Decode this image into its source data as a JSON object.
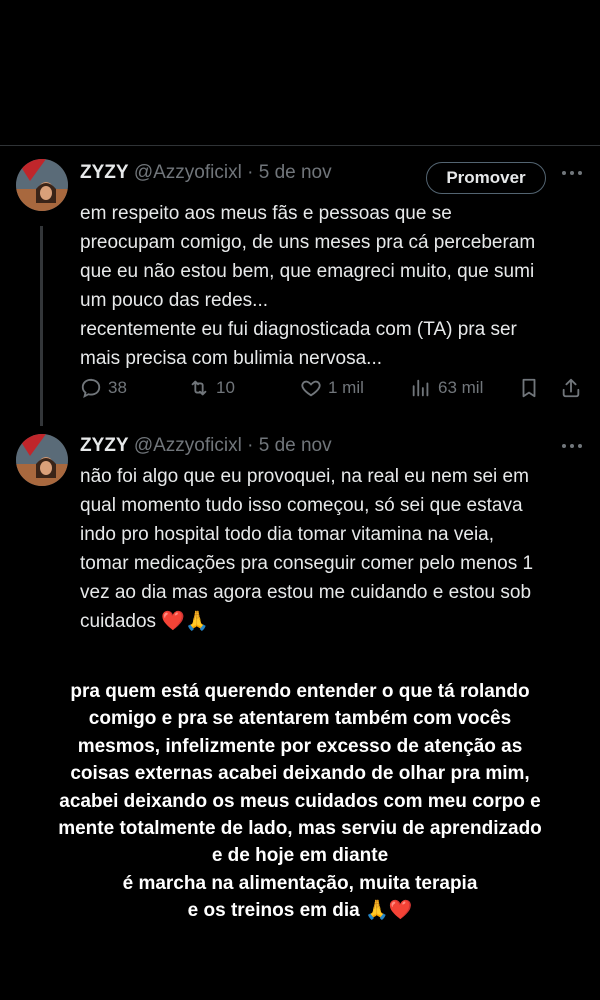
{
  "tweets": [
    {
      "name": "ZYZY",
      "handle": "@Azzyoficixl",
      "separator": "·",
      "date": "5 de nov",
      "promote_label": "Promover",
      "lines": [
        "em respeito aos meus fãs e pessoas que se",
        "preocupam comigo, de uns meses pra cá perceberam",
        "que eu não estou bem, que emagreci muito, que sumi",
        "um pouco das redes...",
        "recentemente eu fui diagnosticada  com  (TA) pra  ser",
        "mais  precisa com  bulimia  nervosa..."
      ],
      "stats": {
        "replies": "38",
        "reposts": "10",
        "likes": "1 mil",
        "views": "63 mil"
      }
    },
    {
      "name": "ZYZY",
      "handle": "@Azzyoficixl",
      "separator": "·",
      "date": "5 de nov",
      "lines": [
        "não foi algo que eu provoquei, na real eu nem sei em",
        "qual momento tudo isso começou, só sei que estava",
        "indo pro hospital todo dia tomar vitamina na veia,",
        "tomar medicações pra conseguir comer pelo menos 1",
        "vez ao dia  mas  agora estou me cuidando e estou sob",
        "cuidados ❤️🙏"
      ]
    }
  ],
  "story_caption": [
    "pra quem está querendo entender o que tá rolando",
    "comigo e pra se atentarem também com vocês",
    "mesmos, infelizmente por excesso de atenção as",
    "coisas externas acabei deixando de olhar pra mim,",
    "acabei deixando os meus cuidados com meu corpo e",
    "mente totalmente de lado, mas serviu de aprendizado",
    "e de hoje em diante",
    "é marcha na alimentação, muita terapia",
    "e os treinos em dia 🙏❤️"
  ],
  "colors": {
    "background": "#000000",
    "text": "#e7e9ea",
    "muted": "#71767b",
    "divider": "#2f3336"
  },
  "icons": [
    "avatar",
    "more-icon",
    "reply-icon",
    "repost-icon",
    "like-icon",
    "views-icon",
    "bookmark-icon",
    "share-icon"
  ]
}
